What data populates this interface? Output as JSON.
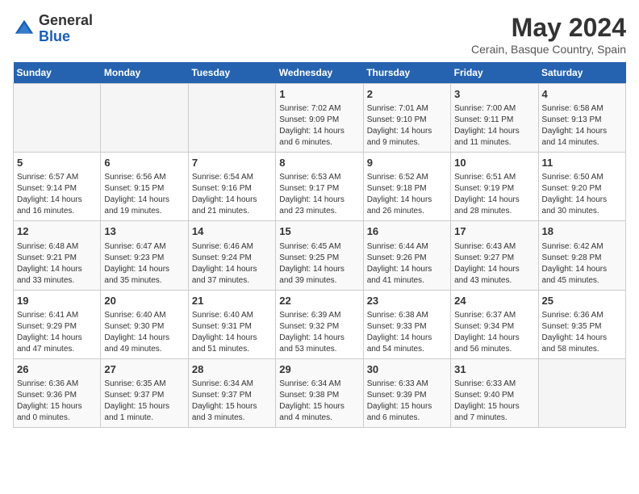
{
  "header": {
    "logo_general": "General",
    "logo_blue": "Blue",
    "month_year": "May 2024",
    "location": "Cerain, Basque Country, Spain"
  },
  "days_of_week": [
    "Sunday",
    "Monday",
    "Tuesday",
    "Wednesday",
    "Thursday",
    "Friday",
    "Saturday"
  ],
  "weeks": [
    [
      {
        "day": "",
        "info": ""
      },
      {
        "day": "",
        "info": ""
      },
      {
        "day": "",
        "info": ""
      },
      {
        "day": "1",
        "info": "Sunrise: 7:02 AM\nSunset: 9:09 PM\nDaylight: 14 hours\nand 6 minutes."
      },
      {
        "day": "2",
        "info": "Sunrise: 7:01 AM\nSunset: 9:10 PM\nDaylight: 14 hours\nand 9 minutes."
      },
      {
        "day": "3",
        "info": "Sunrise: 7:00 AM\nSunset: 9:11 PM\nDaylight: 14 hours\nand 11 minutes."
      },
      {
        "day": "4",
        "info": "Sunrise: 6:58 AM\nSunset: 9:13 PM\nDaylight: 14 hours\nand 14 minutes."
      }
    ],
    [
      {
        "day": "5",
        "info": "Sunrise: 6:57 AM\nSunset: 9:14 PM\nDaylight: 14 hours\nand 16 minutes."
      },
      {
        "day": "6",
        "info": "Sunrise: 6:56 AM\nSunset: 9:15 PM\nDaylight: 14 hours\nand 19 minutes."
      },
      {
        "day": "7",
        "info": "Sunrise: 6:54 AM\nSunset: 9:16 PM\nDaylight: 14 hours\nand 21 minutes."
      },
      {
        "day": "8",
        "info": "Sunrise: 6:53 AM\nSunset: 9:17 PM\nDaylight: 14 hours\nand 23 minutes."
      },
      {
        "day": "9",
        "info": "Sunrise: 6:52 AM\nSunset: 9:18 PM\nDaylight: 14 hours\nand 26 minutes."
      },
      {
        "day": "10",
        "info": "Sunrise: 6:51 AM\nSunset: 9:19 PM\nDaylight: 14 hours\nand 28 minutes."
      },
      {
        "day": "11",
        "info": "Sunrise: 6:50 AM\nSunset: 9:20 PM\nDaylight: 14 hours\nand 30 minutes."
      }
    ],
    [
      {
        "day": "12",
        "info": "Sunrise: 6:48 AM\nSunset: 9:21 PM\nDaylight: 14 hours\nand 33 minutes."
      },
      {
        "day": "13",
        "info": "Sunrise: 6:47 AM\nSunset: 9:23 PM\nDaylight: 14 hours\nand 35 minutes."
      },
      {
        "day": "14",
        "info": "Sunrise: 6:46 AM\nSunset: 9:24 PM\nDaylight: 14 hours\nand 37 minutes."
      },
      {
        "day": "15",
        "info": "Sunrise: 6:45 AM\nSunset: 9:25 PM\nDaylight: 14 hours\nand 39 minutes."
      },
      {
        "day": "16",
        "info": "Sunrise: 6:44 AM\nSunset: 9:26 PM\nDaylight: 14 hours\nand 41 minutes."
      },
      {
        "day": "17",
        "info": "Sunrise: 6:43 AM\nSunset: 9:27 PM\nDaylight: 14 hours\nand 43 minutes."
      },
      {
        "day": "18",
        "info": "Sunrise: 6:42 AM\nSunset: 9:28 PM\nDaylight: 14 hours\nand 45 minutes."
      }
    ],
    [
      {
        "day": "19",
        "info": "Sunrise: 6:41 AM\nSunset: 9:29 PM\nDaylight: 14 hours\nand 47 minutes."
      },
      {
        "day": "20",
        "info": "Sunrise: 6:40 AM\nSunset: 9:30 PM\nDaylight: 14 hours\nand 49 minutes."
      },
      {
        "day": "21",
        "info": "Sunrise: 6:40 AM\nSunset: 9:31 PM\nDaylight: 14 hours\nand 51 minutes."
      },
      {
        "day": "22",
        "info": "Sunrise: 6:39 AM\nSunset: 9:32 PM\nDaylight: 14 hours\nand 53 minutes."
      },
      {
        "day": "23",
        "info": "Sunrise: 6:38 AM\nSunset: 9:33 PM\nDaylight: 14 hours\nand 54 minutes."
      },
      {
        "day": "24",
        "info": "Sunrise: 6:37 AM\nSunset: 9:34 PM\nDaylight: 14 hours\nand 56 minutes."
      },
      {
        "day": "25",
        "info": "Sunrise: 6:36 AM\nSunset: 9:35 PM\nDaylight: 14 hours\nand 58 minutes."
      }
    ],
    [
      {
        "day": "26",
        "info": "Sunrise: 6:36 AM\nSunset: 9:36 PM\nDaylight: 15 hours\nand 0 minutes."
      },
      {
        "day": "27",
        "info": "Sunrise: 6:35 AM\nSunset: 9:37 PM\nDaylight: 15 hours\nand 1 minute."
      },
      {
        "day": "28",
        "info": "Sunrise: 6:34 AM\nSunset: 9:37 PM\nDaylight: 15 hours\nand 3 minutes."
      },
      {
        "day": "29",
        "info": "Sunrise: 6:34 AM\nSunset: 9:38 PM\nDaylight: 15 hours\nand 4 minutes."
      },
      {
        "day": "30",
        "info": "Sunrise: 6:33 AM\nSunset: 9:39 PM\nDaylight: 15 hours\nand 6 minutes."
      },
      {
        "day": "31",
        "info": "Sunrise: 6:33 AM\nSunset: 9:40 PM\nDaylight: 15 hours\nand 7 minutes."
      },
      {
        "day": "",
        "info": ""
      }
    ]
  ]
}
